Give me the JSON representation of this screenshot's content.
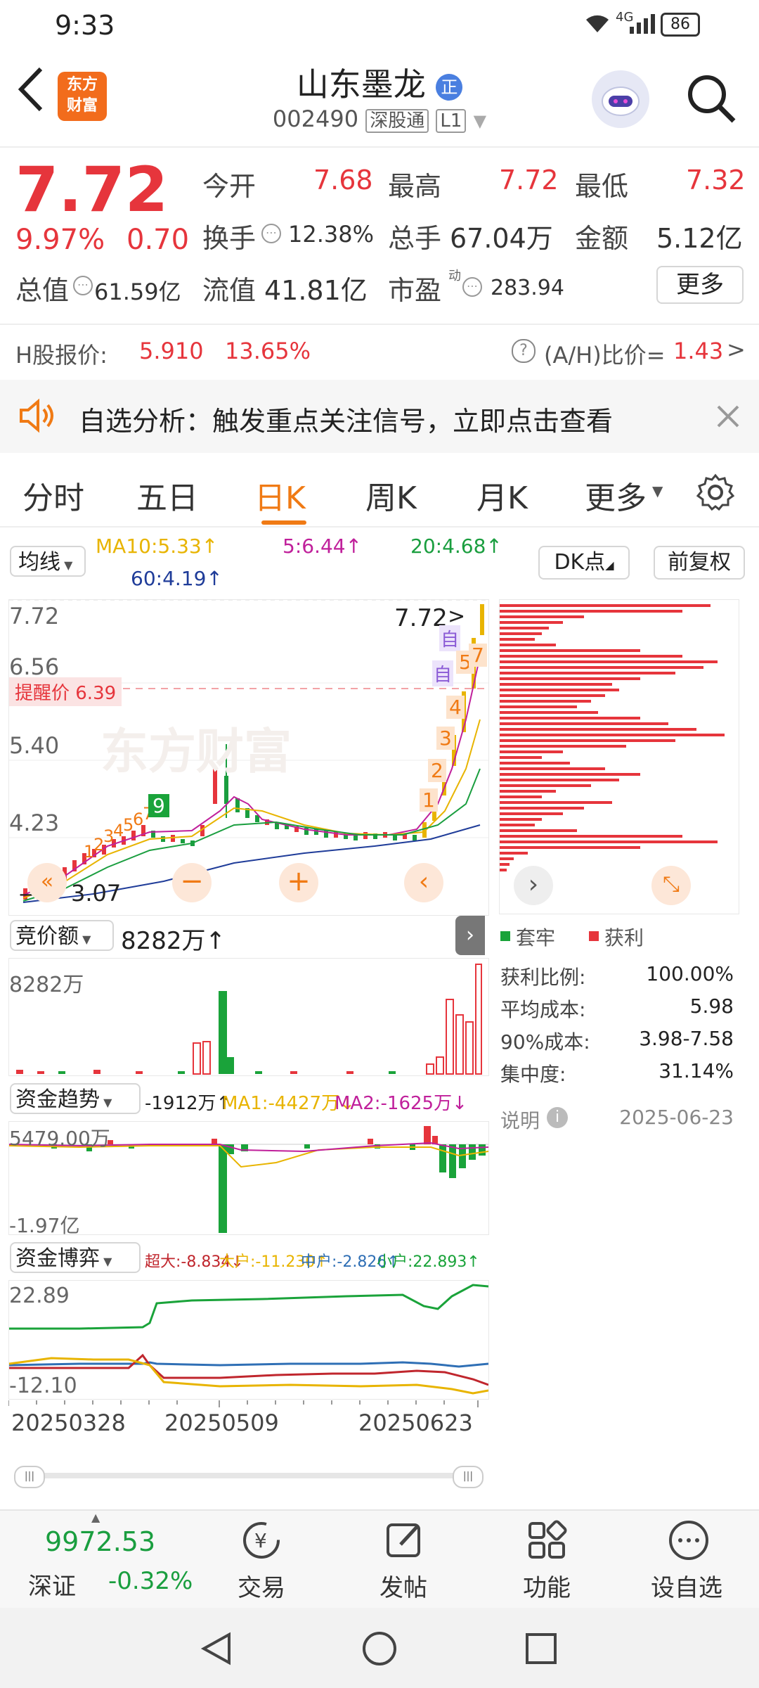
{
  "status_bar": {
    "time": "9:33",
    "signal": "4G",
    "battery": "86"
  },
  "header": {
    "back": "‹",
    "app_logo_line1": "东方",
    "app_logo_line2": "财富",
    "stock_name": "山东墨龙",
    "stock_badge": "正",
    "stock_code": "002490",
    "connect_tag": "深股通",
    "level_tag": "L1"
  },
  "quote": {
    "price": "7.72",
    "change_pct": "9.97%",
    "change": "0.70",
    "open_label": "今开",
    "open": "7.68",
    "high_label": "最高",
    "high": "7.72",
    "low_label": "最低",
    "low": "7.32",
    "turnover_label": "换手",
    "turnover": "12.38%",
    "volume_label": "总手",
    "volume": "67.04万",
    "amount_label": "金额",
    "amount": "5.12亿",
    "mktcap_label": "总值",
    "mktcap": "61.59亿",
    "float_label": "流值",
    "float": "41.81亿",
    "pe_label": "市盈",
    "pe_sup": "动",
    "pe": "283.94",
    "more": "更多"
  },
  "hshare": {
    "label": "H股报价:",
    "price": "5.910",
    "pct": "13.65%",
    "ah_label": "(A/H)比价=",
    "ah": "1.43",
    "arrow": ">"
  },
  "notice": {
    "text": "自选分析：触发重点关注信号，立即点击查看"
  },
  "tabs": [
    "分时",
    "五日",
    "日K",
    "周K",
    "月K",
    "更多"
  ],
  "active_tab": 2,
  "ma": {
    "selector": "均线",
    "ma10": "MA10:5.33↑",
    "ma5": "5:6.44↑",
    "ma20": "20:4.68↑",
    "ma60": "60:4.19↑",
    "dk": "DK点",
    "adjust": "前复权"
  },
  "kline": {
    "y_labels": [
      "7.72",
      "6.56",
      "5.40",
      "4.23",
      "3.07"
    ],
    "last": "7.72",
    "low_mark": "3.07",
    "alert": "提醒价 6.39",
    "watermark": "东方财富",
    "markers": [
      "1",
      "2",
      "3",
      "4",
      "5",
      "7"
    ],
    "self_tags": [
      "自",
      "自"
    ],
    "seq_marks": [
      "1",
      "2",
      "3",
      "4",
      "5",
      "6",
      "7"
    ],
    "seq9": "9"
  },
  "chip": {
    "legend_trapped": "套牢",
    "legend_profit": "获利",
    "rows": [
      {
        "label": "获利比例:",
        "value": "100.00%"
      },
      {
        "label": "平均成本:",
        "value": "5.98"
      },
      {
        "label": "90%成本:",
        "value": "3.98-7.58"
      },
      {
        "label": "集中度:",
        "value": "31.14%"
      }
    ],
    "note": "说明",
    "date": "2025-06-23"
  },
  "auction": {
    "selector": "竞价额",
    "value": "8282万↑",
    "axis_top": "8282万"
  },
  "fund_trend": {
    "selector": "资金趋势",
    "val": "-1912万↑",
    "ma1": "MA1:-4427万↓",
    "ma2": "MA2:-1625万↓",
    "axis_top": "5479.00万",
    "axis_bottom": "-1.97亿"
  },
  "fund_game": {
    "selector": "资金博弈",
    "super": "超大:-8.834↓",
    "big": "大户:-11.230↑",
    "mid": "中户:-2.826↑",
    "small": "小户:22.893↑",
    "axis_top": "22.89",
    "axis_bottom": "-12.10",
    "colors": {
      "super": "#c0262d",
      "big": "#e8b400",
      "mid": "#2f6fb5",
      "small": "#1aa33a"
    }
  },
  "dates": [
    "20250328",
    "20250509",
    "20250623"
  ],
  "bottom": {
    "index_value": "9972.53",
    "index_name": "深证",
    "index_pct": "-0.32%",
    "items": [
      "交易",
      "发帖",
      "功能",
      "设自选"
    ]
  },
  "colors": {
    "up": "#e6353c",
    "down": "#1a9e3f",
    "accent": "#f07a14"
  }
}
